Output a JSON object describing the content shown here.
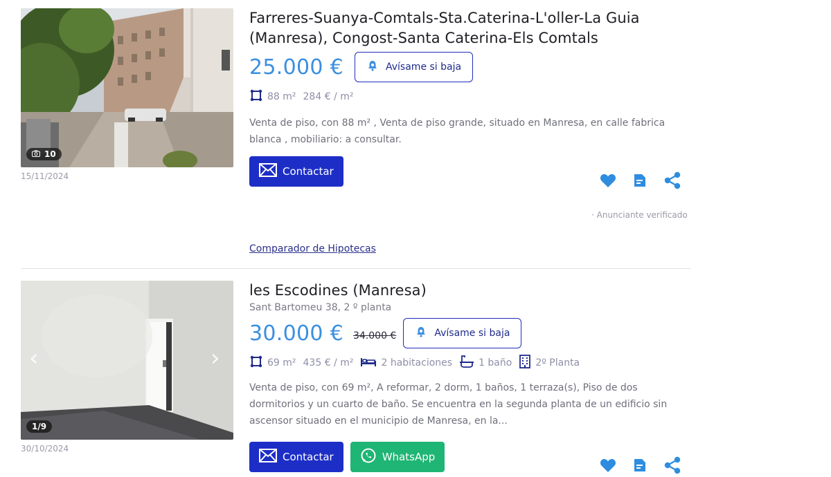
{
  "listings": [
    {
      "title": "Farreres-Suanya-Comtals-Sta.Caterina-L'oller-La Guia (Manresa), Congost-Santa Caterina-Els Comtals",
      "price": "25.000 €",
      "alert_label": "Avísame si baja",
      "area": "88 m²",
      "price_per_m2": "284 € / m²",
      "description": "Venta de piso, con 88 m² , Venta de piso grande, situado en Manresa, en calle fabrica blanca , mobiliario: a consultar.",
      "contact_label": "Contactar",
      "photo_count": "10",
      "date": "15/11/2024",
      "verified": "· Anunciante verificado"
    },
    {
      "title": "les Escodines (Manresa)",
      "address": "Sant Bartomeu 38, 2 º planta",
      "price": "30.000 €",
      "old_price": "34.000 €",
      "alert_label": "Avísame si baja",
      "area": "69 m²",
      "price_per_m2": "435 € / m²",
      "rooms": "2 habitaciones",
      "baths": "1 baño",
      "floor": "2º Planta",
      "description": "Venta de piso, con 69 m², A reformar, 2 dorm, 1 baños, 1 terraza(s), Piso de dos dormitorios y un cuarto de baño. Se encuentra en la segunda planta de un edificio sin ascensor situado en el municipio de Manresa, en la...",
      "contact_label": "Contactar",
      "whatsapp_label": "WhatsApp",
      "photo_counter": "1/9",
      "date": "30/10/2024"
    }
  ],
  "mortgage_link": "Comparador de Hipotecas",
  "colors": {
    "price": "#3b8fe0",
    "contact_bg": "#1d2ec7",
    "whatsapp_bg": "#1fb574",
    "icon_blue": "#2e8de0"
  }
}
